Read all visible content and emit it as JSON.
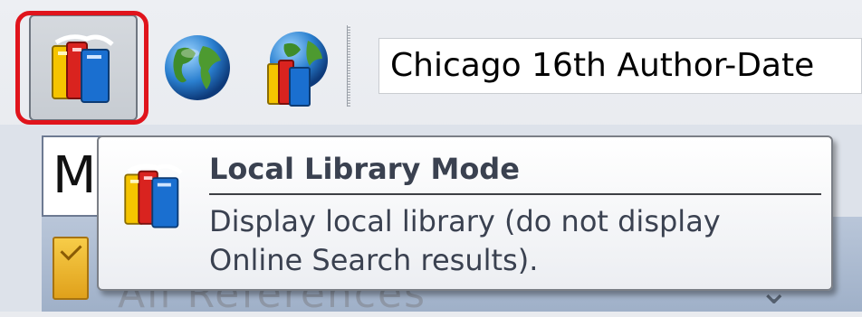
{
  "toolbar": {
    "buttons": [
      {
        "name": "local-library-mode",
        "icon": "books-icon",
        "pressed": true
      },
      {
        "name": "online-search-mode",
        "icon": "globe-icon",
        "pressed": false
      },
      {
        "name": "integrated-library-online-mode",
        "icon": "books-globe-icon",
        "pressed": false
      }
    ],
    "output_style": "Chicago 16th Author-Date"
  },
  "panel": {
    "tab_letter": "M",
    "obscured_text": "All References"
  },
  "tooltip": {
    "title": "Local Library Mode",
    "line1": "Display local library (do not display",
    "line2": "Online Search results)."
  },
  "colors": {
    "highlight_ring": "#e0141c",
    "tooltip_text": "#3a4150"
  }
}
